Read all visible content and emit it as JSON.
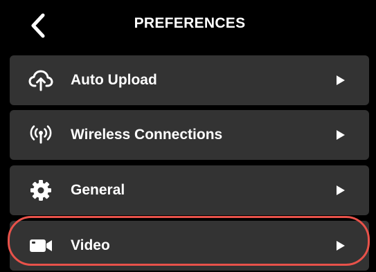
{
  "header": {
    "title": "PREFERENCES",
    "back_icon": "chevron-left-icon"
  },
  "menu": {
    "items": [
      {
        "label": "Auto Upload",
        "icon": "cloud-upload-icon"
      },
      {
        "label": "Wireless Connections",
        "icon": "wireless-icon"
      },
      {
        "label": "General",
        "icon": "gear-icon"
      },
      {
        "label": "Video",
        "icon": "video-camera-icon"
      }
    ],
    "chevron_icon": "play-right-icon"
  },
  "colors": {
    "background": "#000000",
    "item_background": "#333333",
    "text": "#ffffff",
    "highlight": "#e8524a"
  }
}
